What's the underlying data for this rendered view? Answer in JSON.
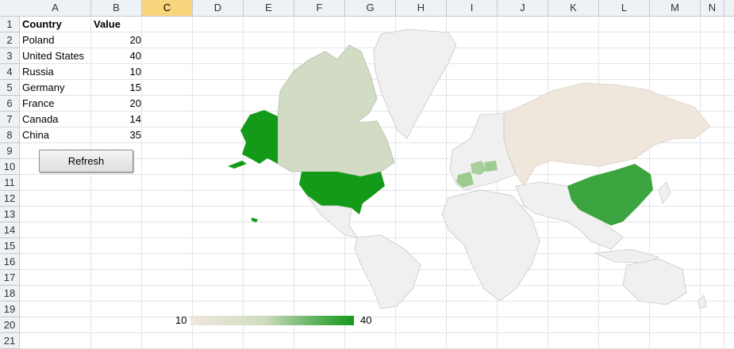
{
  "columns": [
    "A",
    "B",
    "C",
    "D",
    "E",
    "F",
    "G",
    "H",
    "I",
    "J",
    "K",
    "L",
    "M",
    "N"
  ],
  "selected_column": "C",
  "rows": [
    "1",
    "2",
    "3",
    "4",
    "5",
    "6",
    "7",
    "8",
    "9",
    "10",
    "11",
    "12",
    "13",
    "14",
    "15",
    "16",
    "17",
    "18",
    "19",
    "20",
    "21"
  ],
  "table": {
    "header": {
      "country": "Country",
      "value": "Value"
    },
    "rows": [
      {
        "country": "Poland",
        "value": "20"
      },
      {
        "country": "United States",
        "value": "40"
      },
      {
        "country": "Russia",
        "value": "10"
      },
      {
        "country": "Germany",
        "value": "15"
      },
      {
        "country": "France",
        "value": "20"
      },
      {
        "country": "Canada",
        "value": "14"
      },
      {
        "country": "China",
        "value": "35"
      }
    ]
  },
  "refresh_button": {
    "label": "Refresh"
  },
  "legend": {
    "min": "10",
    "max": "40"
  },
  "colors": {
    "min": "#efe6dc",
    "mid": "#cfdcc0",
    "max": "#139a18",
    "no_data": "#f0f0f0",
    "selected_column": "#f9d67d"
  }
}
